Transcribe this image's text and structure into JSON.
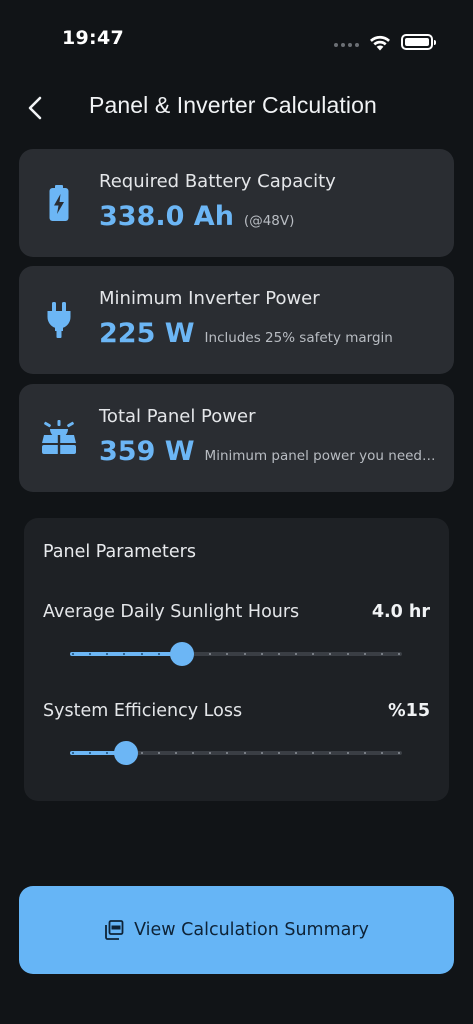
{
  "status_bar": {
    "time": "19:47"
  },
  "header": {
    "title": "Panel & Inverter Calculation"
  },
  "cards": [
    {
      "title": "Required Battery Capacity",
      "value": "338.0 Ah",
      "note": "(@48V)",
      "icon": "battery-charging-icon"
    },
    {
      "title": "Minimum Inverter Power",
      "value": "225 W",
      "note": "Includes 25% safety margin",
      "icon": "plug-icon"
    },
    {
      "title": "Total Panel Power",
      "value": "359 W",
      "note": "Minimum panel power you need ...",
      "icon": "solar-panel-icon"
    }
  ],
  "params": {
    "title": "Panel Parameters",
    "sunlight": {
      "label": "Average Daily Sunlight Hours",
      "value": "4.0 hr",
      "fraction": 0.338
    },
    "efficiency": {
      "label": "System Efficiency Loss",
      "value": "%15",
      "fraction": 0.17
    }
  },
  "summary_button": {
    "label": "View Calculation Summary",
    "icon": "pdf-icon"
  },
  "colors": {
    "accent": "#6cb6f5",
    "background": "#111417",
    "card": "#2a2d32",
    "button": "#66b5f6"
  }
}
